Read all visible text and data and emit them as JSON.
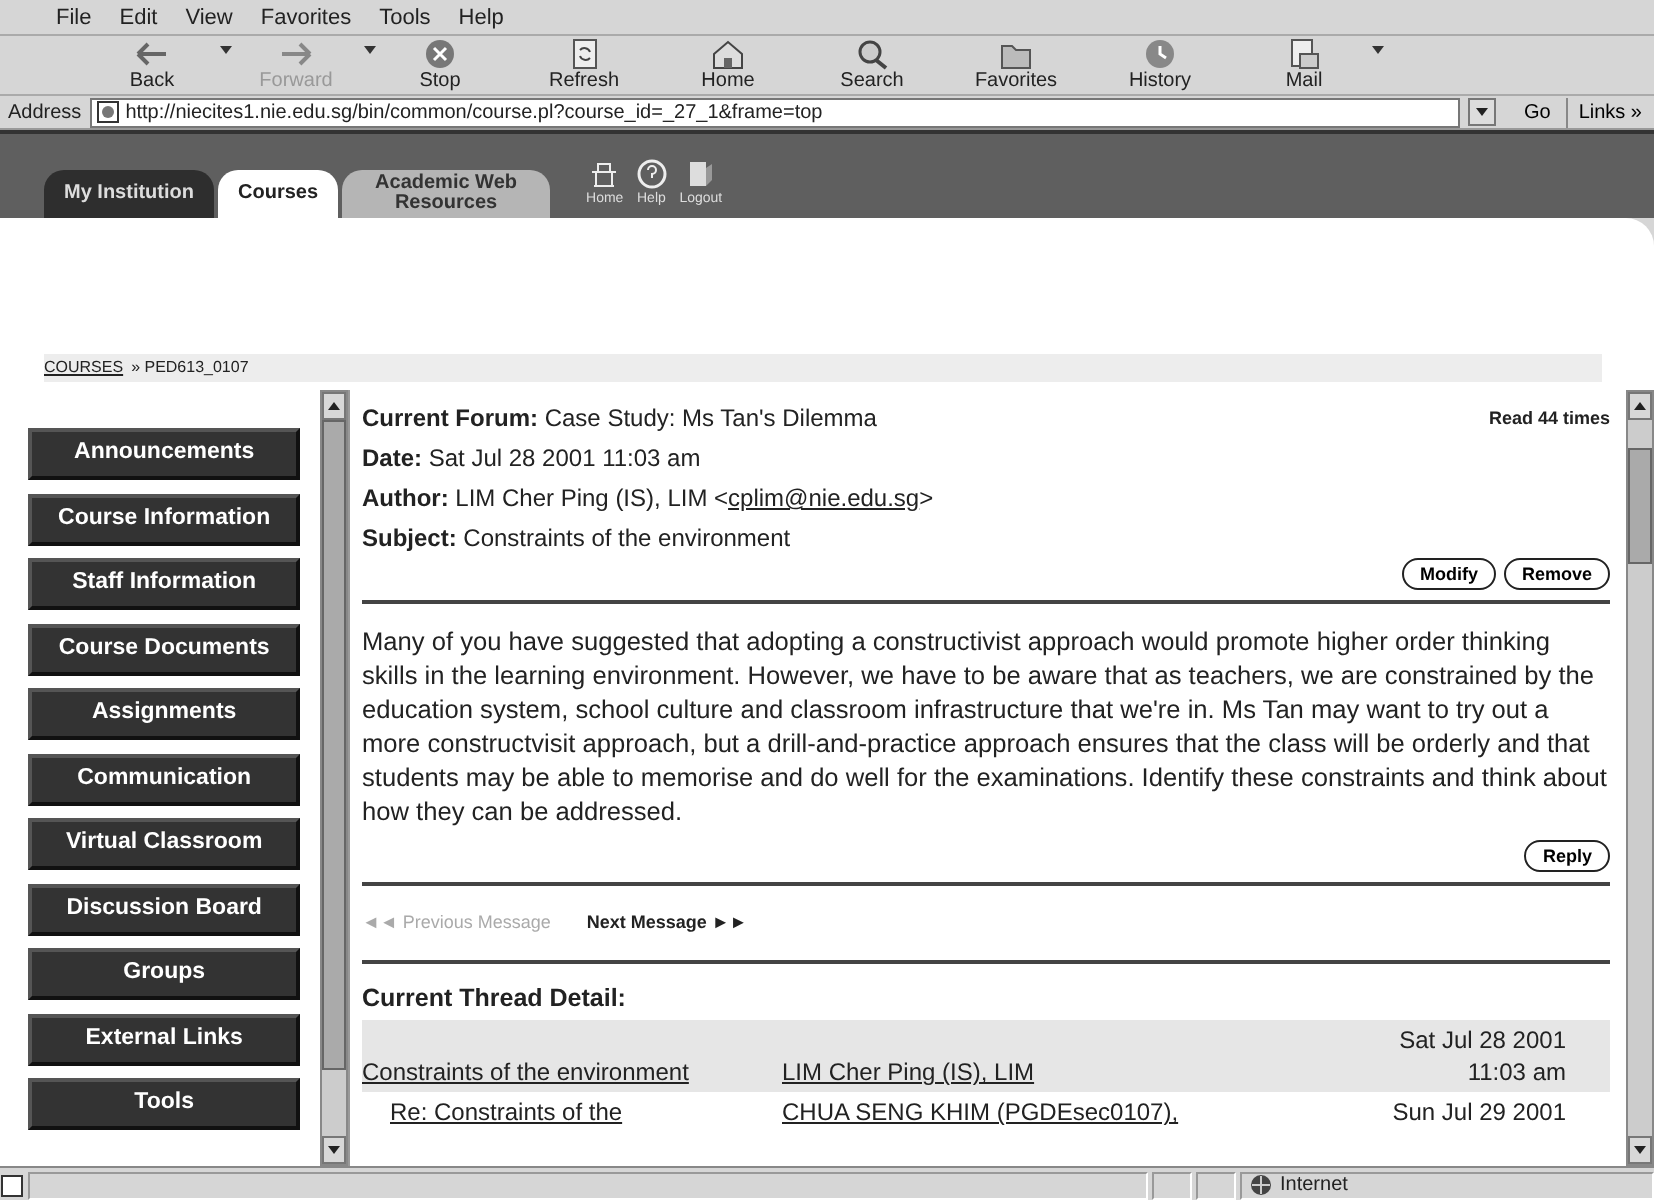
{
  "menu": [
    "File",
    "Edit",
    "View",
    "Favorites",
    "Tools",
    "Help"
  ],
  "toolbar": [
    {
      "label": "Back",
      "disabled": false,
      "dropdown": true
    },
    {
      "label": "Forward",
      "disabled": true,
      "dropdown": true
    },
    {
      "label": "Stop",
      "disabled": false,
      "dropdown": false
    },
    {
      "label": "Refresh",
      "disabled": false,
      "dropdown": false
    },
    {
      "label": "Home",
      "disabled": false,
      "dropdown": false
    },
    {
      "label": "Search",
      "disabled": false,
      "dropdown": false
    },
    {
      "label": "Favorites",
      "disabled": false,
      "dropdown": false
    },
    {
      "label": "History",
      "disabled": false,
      "dropdown": false
    },
    {
      "label": "Mail",
      "disabled": false,
      "dropdown": true
    }
  ],
  "address": {
    "label": "Address",
    "url": "http://niecites1.nie.edu.sg/bin/common/course.pl?course_id=_27_1&frame=top",
    "go": "Go",
    "links": "Links »"
  },
  "tabs": [
    {
      "label": "My Institution",
      "selected": false
    },
    {
      "label": "Courses",
      "selected": true
    },
    {
      "label": "Academic Web Resources",
      "selected": false
    }
  ],
  "header_links": [
    "Home",
    "Help",
    "Logout"
  ],
  "breadcrumb": {
    "link": "COURSES",
    "current": "» PED613_0107"
  },
  "nav": [
    "Announcements",
    "Course Information",
    "Staff Information",
    "Course Documents",
    "Assignments",
    "Communication",
    "Virtual Classroom",
    "Discussion Board",
    "Groups",
    "External Links",
    "Tools"
  ],
  "message": {
    "fields": [
      {
        "label": "Current Forum:",
        "value": "Case Study: Ms Tan's Dilemma"
      },
      {
        "label": "Date:",
        "value": "Sat Jul 28 2001 11:03 am"
      },
      {
        "label": "Author:",
        "value": "LIM Cher Ping (IS), LIM <",
        "email": "cplim@nie.edu.sg",
        "after": ">"
      },
      {
        "label": "Subject:",
        "value": "Constraints of the environment"
      }
    ],
    "read_count": "Read 44 times",
    "actions": [
      "Modify",
      "Remove"
    ],
    "body": "Many of you have suggested that adopting a constructivist approach would promote higher order thinking skills in the learning environment. However, we have to be aware that as teachers, we are constrained by the education system, school culture and classroom infrastructure that we're in. Ms Tan may want to try out a more constructvisit approach, but a drill-and-practice approach ensures that the class will be orderly and that students may be able to memorise and do well for the examinations. Identify these constraints and think about how they can be addressed.",
    "reply": "Reply"
  },
  "pager": [
    {
      "label": "◄◄ Previous Message",
      "disabled": true
    },
    {
      "label": "Next Message ►►",
      "disabled": false
    }
  ],
  "thread": {
    "heading": "Current Thread Detail:",
    "rows": [
      {
        "subject": "Constraints of the environment",
        "author": "LIM Cher Ping (IS), LIM",
        "date": "Sat Jul 28 2001 11:03 am",
        "selected": true,
        "reply": false
      },
      {
        "subject": "Re: Constraints of the",
        "author": "CHUA SENG KHIM (PGDEsec0107),",
        "date": "Sun Jul 29 2001",
        "selected": false,
        "reply": true
      }
    ]
  },
  "status": {
    "zone": "Internet"
  }
}
